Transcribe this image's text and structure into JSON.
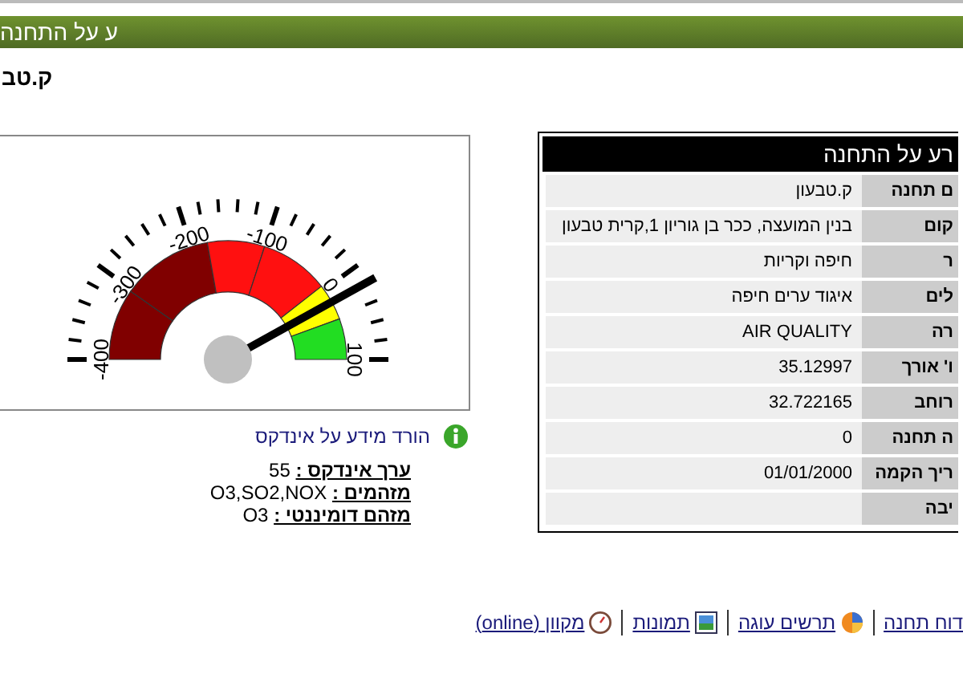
{
  "header": {
    "title": "ע על התחנה"
  },
  "station_name": "ק.טב",
  "gauge": {
    "tick_labels": [
      "-400",
      "-300",
      "-200",
      "-100",
      "0",
      "100"
    ]
  },
  "info_table": {
    "title": "רע על התחנה",
    "rows": [
      {
        "label": "ם תחנה",
        "value": "ק.טבעון"
      },
      {
        "label": "קום",
        "value": "בנין המועצה, ככר בן גוריון 1,קרית טבעון"
      },
      {
        "label": "ר",
        "value": "חיפה וקריות"
      },
      {
        "label": "לים",
        "value": "איגוד ערים חיפה"
      },
      {
        "label": "רה",
        "value": "AIR QUALITY"
      },
      {
        "label": "ו' אורך",
        "value": "35.12997"
      },
      {
        "label": "רוחב",
        "value": "32.722165"
      },
      {
        "label": "ה תחנה",
        "value": "0"
      },
      {
        "label": "ריך הקמה",
        "value": "01/01/2000"
      },
      {
        "label": "יבה",
        "value": ""
      }
    ]
  },
  "index_info": {
    "download_link": "הורד מידע על אינדקס",
    "fields": [
      {
        "label": "ערך אינדקס :",
        "value": "55"
      },
      {
        "label": "מזהמים :",
        "value": "O3,SO2,NOX"
      },
      {
        "label": "מזהם דומיננטי :",
        "value": "O3"
      }
    ]
  },
  "footer_links": [
    {
      "kind": "plain",
      "label": "דוח תחנה"
    },
    {
      "kind": "pie",
      "label": "תרשים עוגה"
    },
    {
      "kind": "image",
      "label": "תמונות"
    },
    {
      "kind": "clock",
      "label": "מקוון (online)"
    }
  ]
}
